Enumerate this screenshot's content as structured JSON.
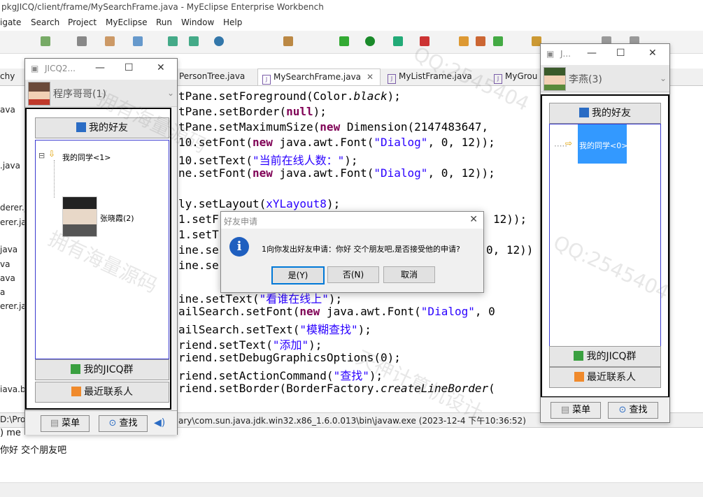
{
  "eclipse": {
    "title": "pkgJICQ/client/frame/MySearchFrame.java - MyEclipse Enterprise Workbench",
    "menus": [
      "igate",
      "Search",
      "Project",
      "MyEclipse",
      "Run",
      "Window",
      "Help"
    ],
    "tabs": [
      "PersonTree.java",
      "MySearchFrame.java",
      "MyListFrame.java",
      "MyGrou"
    ],
    "left_pkg": [
      "chy",
      "ava",
      ".java",
      "derer.j",
      "erer.ja",
      "java",
      "va",
      "ava",
      "a",
      "erer.jav",
      "iava.ba"
    ],
    "code_lines": [
      [
        [
          "tPane.setForeground(Color.",
          ""
        ],
        [
          "black",
          "it"
        ],
        [
          ");",
          ""
        ]
      ],
      [
        [
          "tPane.setBorder(",
          ""
        ],
        [
          "null",
          "kw"
        ],
        [
          ");",
          ""
        ]
      ],
      [
        [
          "tPane.setMaximumSize(",
          ""
        ],
        [
          "new",
          "kw"
        ],
        [
          " Dimension(2147483647,",
          ""
        ]
      ],
      [
        [
          "10.setFont(",
          ""
        ],
        [
          "new",
          "kw"
        ],
        [
          " java.awt.Font(",
          ""
        ],
        [
          "\"Dialog\"",
          "str"
        ],
        [
          ", 0, 12));",
          ""
        ]
      ],
      [
        [
          "10.setText(",
          ""
        ],
        [
          "\"当前在线人数：\"",
          "str"
        ],
        [
          ");",
          ""
        ]
      ],
      [
        [
          "ne.setFont(",
          ""
        ],
        [
          "new",
          "kw"
        ],
        [
          " java.awt.Font(",
          ""
        ],
        [
          "\"Dialog\"",
          "str"
        ],
        [
          ", 0, 12));",
          ""
        ]
      ],
      [
        [
          "",
          ""
        ]
      ],
      [
        [
          "ly.setLayout(",
          ""
        ],
        [
          "xYLayout8",
          "str"
        ],
        [
          ");",
          ""
        ]
      ],
      [
        [
          "1.setF",
          ""
        ]
      ],
      [
        [
          "1.setT",
          ""
        ]
      ],
      [
        [
          "ine.se",
          ""
        ]
      ],
      [
        [
          "ine.se",
          ""
        ]
      ],
      [
        [
          "",
          ""
        ]
      ],
      [
        [
          "ine.setText(",
          ""
        ],
        [
          "\"看谁在线上\"",
          "str"
        ],
        [
          ");",
          ""
        ]
      ],
      [
        [
          "ailSearch.setFont(",
          ""
        ],
        [
          "new",
          "kw"
        ],
        [
          " java.awt.Font(",
          ""
        ],
        [
          "\"Dialog\"",
          "str"
        ],
        [
          ", 0",
          ""
        ]
      ],
      [
        [
          "ailSearch.setText(",
          ""
        ],
        [
          "\"模糊查找\"",
          "str"
        ],
        [
          ");",
          ""
        ]
      ],
      [
        [
          "riend.setText(",
          ""
        ],
        [
          "\"添加\"",
          "str"
        ],
        [
          ");",
          ""
        ]
      ],
      [
        [
          "riend.setDebugGraphicsOptions(0);",
          ""
        ]
      ],
      [
        [
          "riend.setActionCommand(",
          ""
        ],
        [
          "\"查找\"",
          "str"
        ],
        [
          ");",
          ""
        ]
      ],
      [
        [
          "riend.setBorder(BorderFactory.",
          ""
        ],
        [
          "createLineBorder",
          "it"
        ],
        [
          "(",
          ""
        ]
      ]
    ],
    "right_tail": [
      "12));",
      "0, 12))"
    ],
    "console_header": "D:\\Prog",
    "console_path": "ary\\com.sun.java.jdk.win32.x86_1.6.0.013\\bin\\javaw.exe (2023-12-4 下午10:36:52)",
    "console_lines": [
      ") me",
      "你好 交个朋友吧"
    ]
  },
  "win_left": {
    "title": "JICQ2...",
    "user": "程序哥哥(1)",
    "my_friends": "我的好友",
    "group": "我的同学<1>",
    "contact": "张晓霞(2)",
    "jicq_group": "我的JICQ群",
    "recent": "最近联系人",
    "menu": "菜单",
    "search": "查找"
  },
  "win_right": {
    "title": "J...",
    "user": "李燕(3)",
    "my_friends": "我的好友",
    "group": "我的同学<0>",
    "jicq_group": "我的JICQ群",
    "recent": "最近联系人",
    "menu": "菜单",
    "search": "查找"
  },
  "dialog": {
    "title": "好友申请",
    "message": "1向你发出好友申请：你好 交个朋友吧,是否接受他的申请?",
    "yes": "是(Y)",
    "no": "否(N)",
    "cancel": "取消"
  },
  "watermarks": [
    "拥有海量源码",
    "QQ:2545404",
    "天神计算机设计",
    "QQ:2545404",
    "拥有海量源码"
  ],
  "colors": {
    "keyword": "#7f0055",
    "string": "#2a00ff",
    "selection": "#3399ff"
  }
}
